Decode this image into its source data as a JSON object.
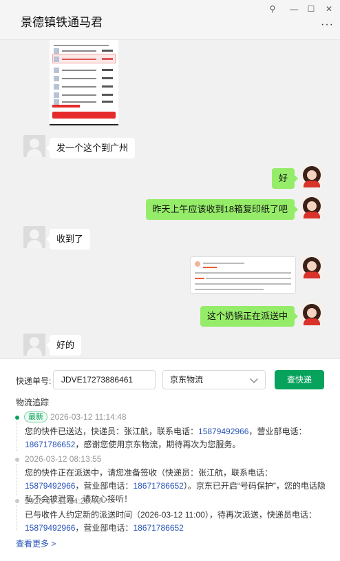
{
  "window": {
    "title": "景德镇铁通马君",
    "pin_icon": "pin-icon",
    "minimize_icon": "minimize-icon",
    "maximize_icon": "maximize-icon",
    "close_icon": "close-icon",
    "more_icon": "more-icon"
  },
  "messages": [
    {
      "side": "left",
      "kind": "text",
      "text": "发一个这个到广州"
    },
    {
      "side": "right",
      "kind": "text",
      "text": "好"
    },
    {
      "side": "right",
      "kind": "text",
      "text": "昨天上午应该收到18箱复印纸了吧"
    },
    {
      "side": "left",
      "kind": "text",
      "text": "收到了"
    },
    {
      "side": "right",
      "kind": "text",
      "text": "这个奶锅正在派送中"
    },
    {
      "side": "left",
      "kind": "text",
      "text": "好的"
    }
  ],
  "tracking": {
    "number_label": "快递单号:",
    "number_value": "JDVE17273886461",
    "carrier_value": "京东物流",
    "query_button": "查快递",
    "section_title": "物流追踪",
    "latest_badge": "最新",
    "events": [
      {
        "time": "2026-03-12 11:14:48",
        "parts": [
          "您的快件已送达，快递员：张江航，联系电话：",
          "15879492966",
          "，营业部电话：",
          "18671786652",
          "，感谢您使用京东物流，期待再次为您服务。"
        ]
      },
      {
        "time": "2026-03-12 08:13:55",
        "parts": [
          "您的快件正在派送中，请您准备签收（快递员：张江航，联系电话：",
          "15879492966",
          "，营业部电话：",
          "18671786652",
          "）。京东已开启“号码保护”，您的电话隐私不会被泄露，请放心接听！"
        ]
      },
      {
        "time": "2026-03-11 14:29:46",
        "parts": [
          "已与收件人约定新的派送时间（2026-03-12 11:00），待再次派送，快递员电话：",
          "15879492966",
          "，营业部电话：",
          "18671786652",
          ""
        ]
      }
    ],
    "see_more": "查看更多 >"
  },
  "colors": {
    "green_bubble": "#95ec69",
    "primary_green": "#07a25c",
    "phone_link": "#2a55b8"
  }
}
